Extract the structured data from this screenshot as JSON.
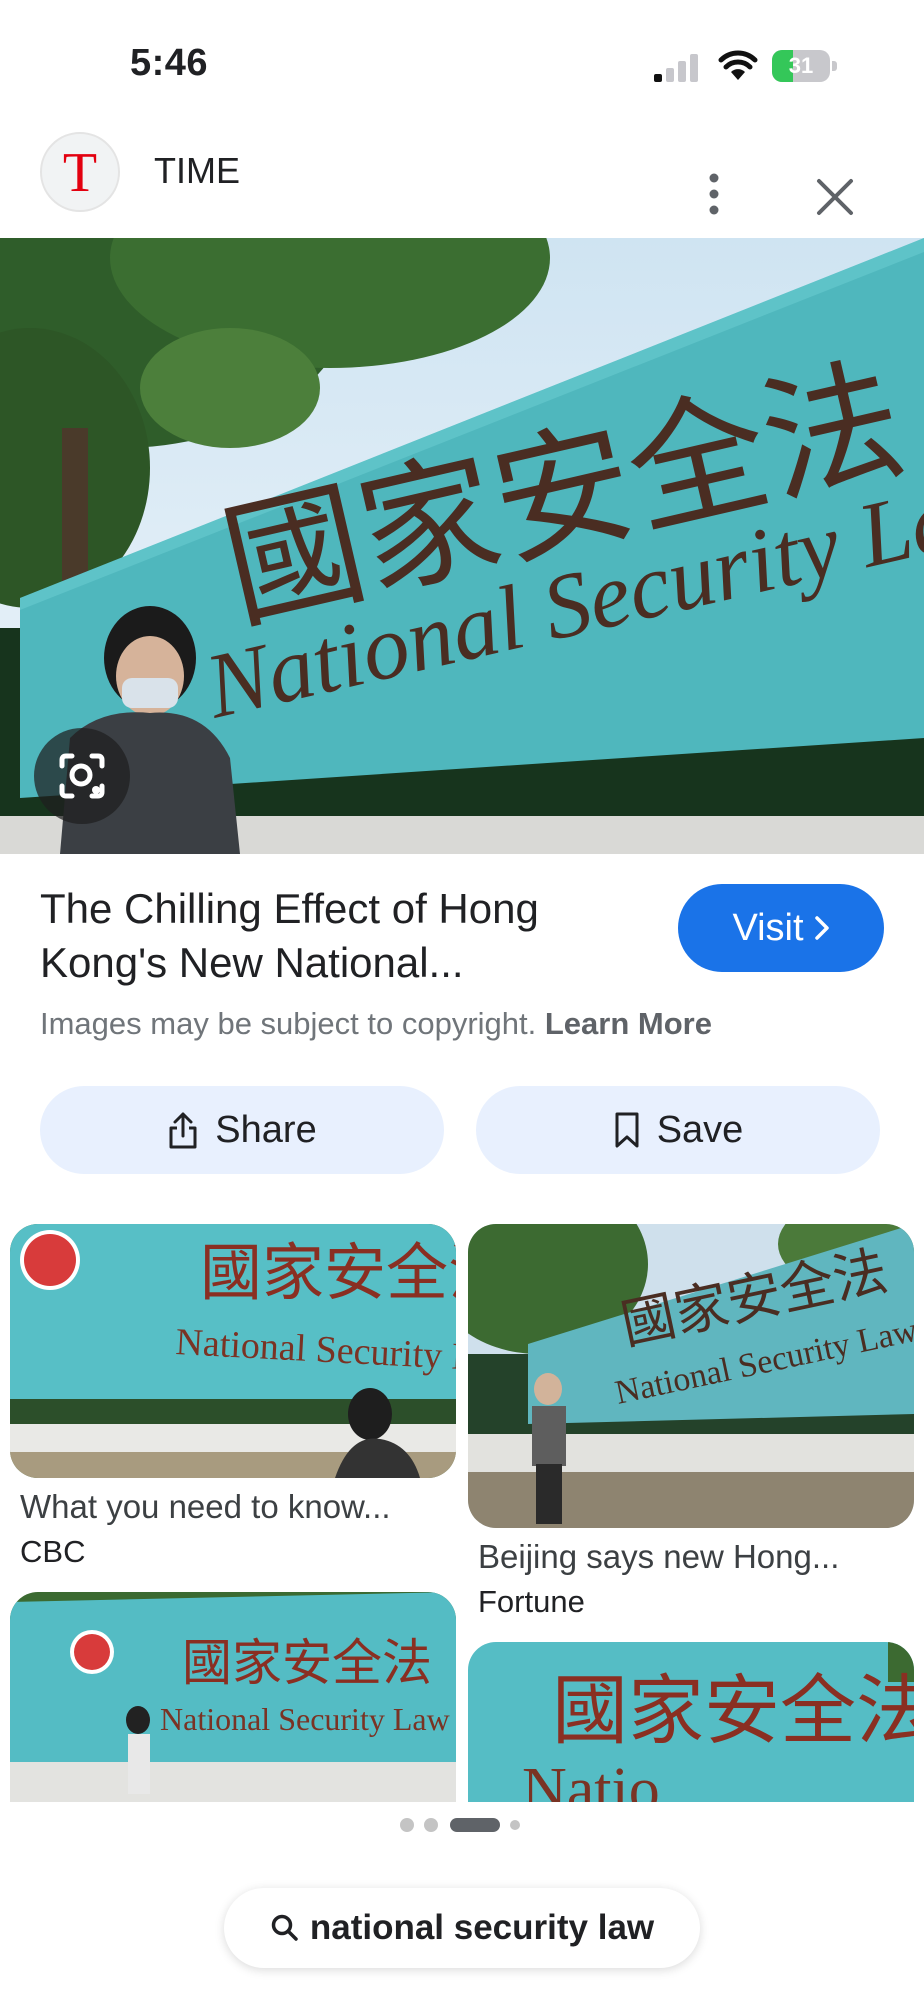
{
  "status_bar": {
    "time": "5:46",
    "battery": "31"
  },
  "header": {
    "source_name": "TIME",
    "logo_letter": "T"
  },
  "hero": {
    "sign_cn": "國家安全法",
    "sign_en": "National Security Law"
  },
  "result": {
    "title_line1": "The Chilling Effect of Hong",
    "title_line2": "Kong's New National...",
    "visit_label": "Visit",
    "copyright_text": "Images may be subject to copyright.",
    "learn_more": "Learn More"
  },
  "actions": {
    "share_label": "Share",
    "save_label": "Save"
  },
  "related": [
    {
      "title": "What you need to know...",
      "source": "CBC",
      "sign_cn": "國家安全法",
      "sign_en": "National Security Law"
    },
    {
      "title": "Beijing says new Hong...",
      "source": "Fortune",
      "sign_cn": "國家安全法",
      "sign_en": "National Security Law"
    },
    {
      "title": "",
      "source": "",
      "sign_cn": "國家安全法",
      "sign_en": "National Security Law"
    },
    {
      "title": "",
      "source": "",
      "sign_cn": "國家安全法",
      "sign_en": "Natio"
    }
  ],
  "search": {
    "query": "national security law"
  },
  "colors": {
    "accent": "#1a73e8",
    "pill": "#e8f0fe",
    "banner": "#4fb7bd",
    "battery_green": "#34c759"
  }
}
